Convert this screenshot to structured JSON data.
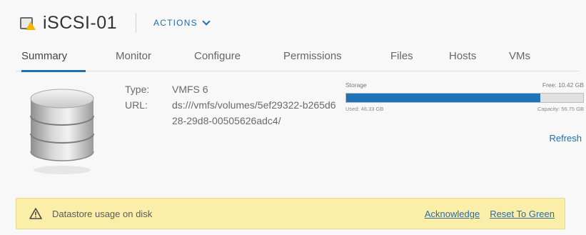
{
  "header": {
    "title": "iSCSI-01",
    "actions_label": "ACTIONS"
  },
  "tabs": [
    {
      "label": "Summary",
      "active": true
    },
    {
      "label": "Monitor",
      "active": false
    },
    {
      "label": "Configure",
      "active": false
    },
    {
      "label": "Permissions",
      "active": false
    },
    {
      "label": "Files",
      "active": false
    },
    {
      "label": "Hosts",
      "active": false
    },
    {
      "label": "VMs",
      "active": false
    }
  ],
  "properties": {
    "type_label": "Type:",
    "type_value": "VMFS 6",
    "url_label": "URL:",
    "url_value": "ds:///vmfs/volumes/5ef29322-b265d628-29d8-00505626adc4/"
  },
  "storage": {
    "label": "Storage",
    "free": "Free: 10.42 GB",
    "used": "Used: 46.33 GB",
    "capacity": "Capacity: 56.75 GB",
    "used_fraction": 0.82,
    "bar_color": "#1e74b8",
    "refresh_label": "Refresh"
  },
  "alert": {
    "icon": "warning-icon",
    "message": "Datastore usage on disk",
    "acknowledge_label": "Acknowledge",
    "reset_label": "Reset To Green",
    "background": "#fbeea8"
  }
}
